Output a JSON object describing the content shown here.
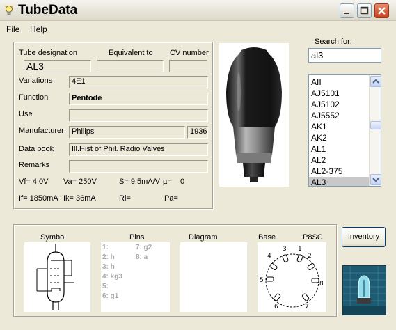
{
  "window": {
    "title": "TubeData"
  },
  "menu": {
    "file": "File",
    "help": "Help"
  },
  "fields": {
    "tube_designation_label": "Tube designation",
    "equivalent_to_label": "Equivalent to",
    "cv_number_label": "CV number",
    "tube_designation": "AL3",
    "equivalent_to": "",
    "cv_number": "",
    "variations_label": "Variations",
    "variations": "4E1",
    "function_label": "Function",
    "function": "Pentode",
    "use_label": "Use",
    "use": "",
    "manufacturer_label": "Manufacturer",
    "manufacturer": "Philips",
    "year": "1936",
    "data_book_label": "Data book",
    "data_book": "Ill.Hist of Phil. Radio Valves",
    "remarks_label": "Remarks",
    "remarks": ""
  },
  "specs": {
    "vf": "Vf= 4,0V",
    "va": "Va= 250V",
    "s": "S= 9,5mA/V",
    "mu": "µ=",
    "mu_value": "0",
    "if": "If= 1850mA",
    "ik": "Ik= 36mA",
    "ri": "Ri=",
    "pa": "Pa="
  },
  "search": {
    "label": "Search for:",
    "value": "al3"
  },
  "tube_list": {
    "items": [
      "AII",
      "AJ5101",
      "AJ5102",
      "AJ5552",
      "AK1",
      "AK2",
      "AL1",
      "AL2",
      "AL2-375",
      "AL3"
    ],
    "selected": "AL3"
  },
  "bottom": {
    "symbol_label": "Symbol",
    "pins_label": "Pins",
    "diagram_label": "Diagram",
    "base_label": "Base",
    "base_type": "P8SC",
    "pins_left": [
      "1:",
      "2: h",
      "3: h",
      "4: kg3",
      "5:",
      "6: g1"
    ],
    "pins_right": [
      "7: g2",
      "8: a"
    ],
    "base_pins": [
      "1",
      "2",
      "3",
      "4",
      "5",
      "6",
      "7",
      "8"
    ]
  },
  "buttons": {
    "inventory": "Inventory"
  },
  "icons": {
    "app": "lightbulb-icon",
    "minimize": "minimize-icon",
    "maximize": "maximize-icon",
    "close": "close-icon",
    "scroll_up": "chevron-up-icon",
    "scroll_down": "chevron-down-icon",
    "logo": "tube-logo-icon"
  }
}
